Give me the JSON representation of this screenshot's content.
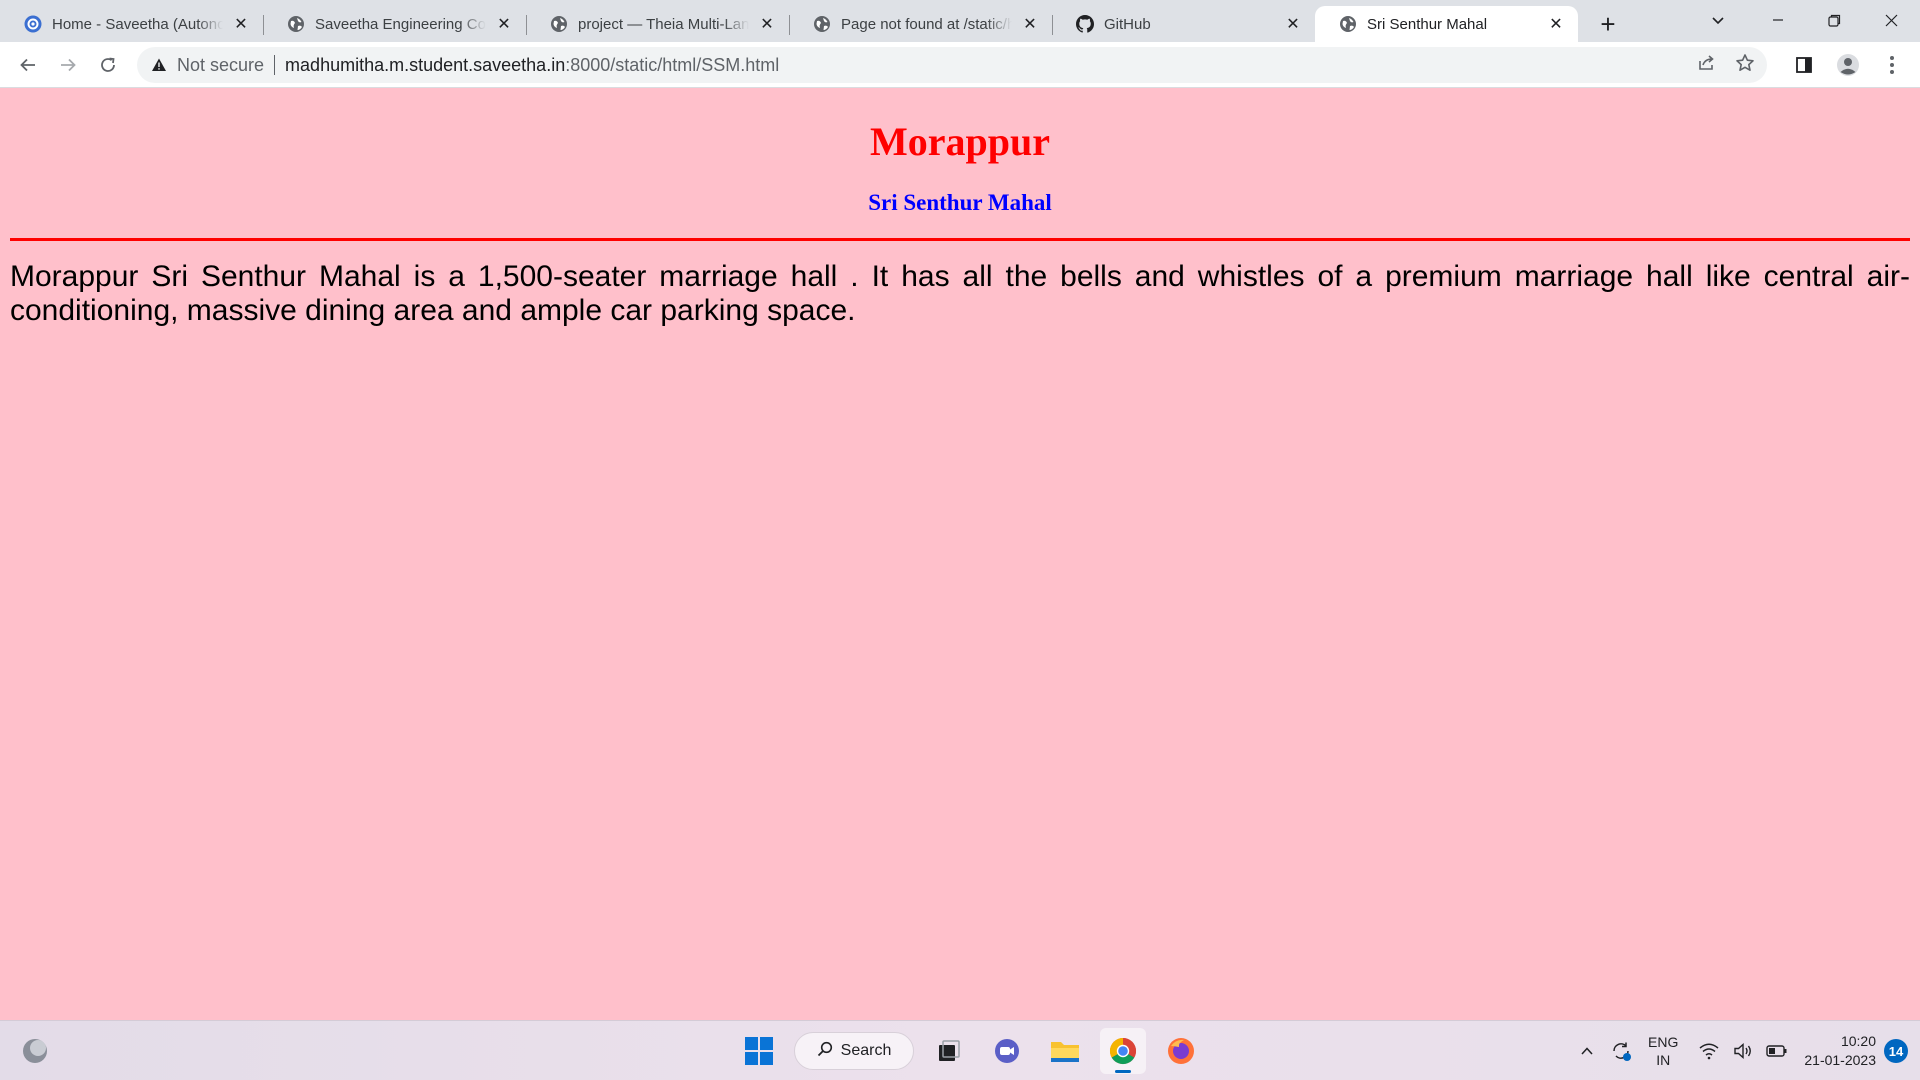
{
  "browser": {
    "tabs": [
      {
        "title": "Home - Saveetha (Autonomous)",
        "favicon": "saveetha-icon",
        "active": false
      },
      {
        "title": "Saveetha Engineering College",
        "favicon": "globe-icon",
        "active": false
      },
      {
        "title": "project — Theia Multi-Language",
        "favicon": "globe-icon",
        "active": false
      },
      {
        "title": "Page not found at /static/html",
        "favicon": "globe-icon",
        "active": false
      },
      {
        "title": "GitHub",
        "favicon": "github-icon",
        "active": false
      },
      {
        "title": "Sri Senthur Mahal",
        "favicon": "globe-icon",
        "active": true
      }
    ],
    "address_bar": {
      "security_label": "Not secure",
      "url_host": "madhumitha.m.student.saveetha.in",
      "url_rest": ":8000/static/html/SSM.html"
    }
  },
  "page": {
    "heading": "Morappur",
    "subheading": "Sri Senthur Mahal",
    "paragraph": "Morappur Sri Senthur Mahal is a 1,500-seater marriage hall . It has all the bells and whistles of a premium marriage hall like central air-conditioning, massive dining area and ample car parking space.",
    "colors": {
      "background": "#ffc0cb",
      "heading": "#ff0000",
      "subheading": "#0000ff",
      "rule": "#ff0000"
    }
  },
  "taskbar": {
    "search_label": "Search",
    "language_line1": "ENG",
    "language_line2": "IN",
    "time": "10:20",
    "date": "21-01-2023",
    "notification_count": "14"
  }
}
